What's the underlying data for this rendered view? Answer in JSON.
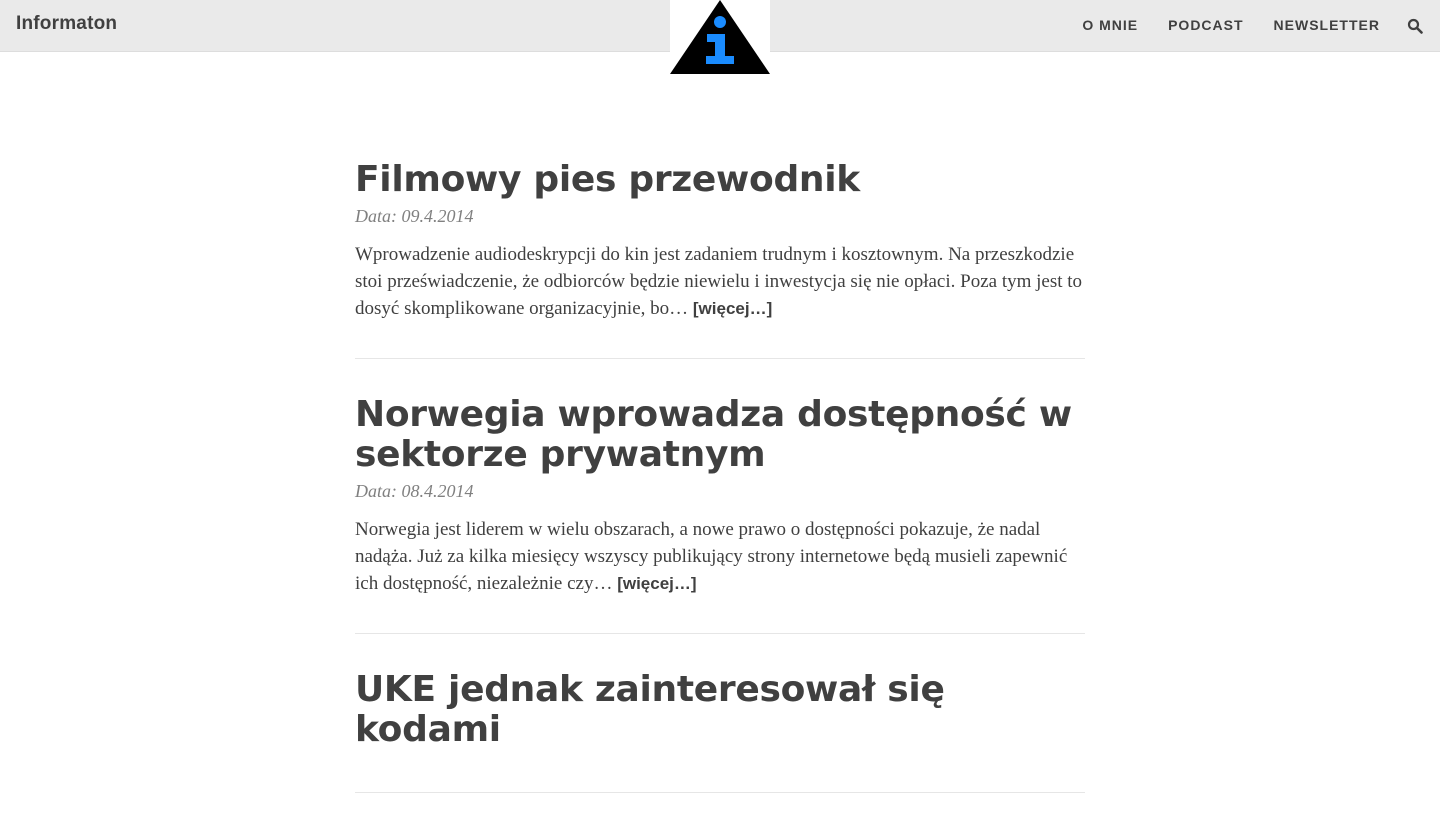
{
  "navbar": {
    "brand": "Informaton",
    "links": [
      "O MNIE",
      "PODCAST",
      "NEWSLETTER"
    ],
    "search_icon": "search-icon",
    "logo_icon": "info-triangle-icon"
  },
  "colors": {
    "navbar_bg": "#eaeaea",
    "text": "#404040",
    "meta": "#808080",
    "logo_black": "#000000",
    "logo_blue": "#1a8cff"
  },
  "posts": [
    {
      "title": "Filmowy pies przewodnik",
      "date": "Data: 09.4.2014",
      "excerpt": "Wprowadzenie audiodeskrypcji do kin jest zadaniem trudnym i kosztownym. Na przeszkodzie stoi przeświadczenie, że odbiorców będzie niewielu i inwestycja się nie opłaci. Poza tym jest to dosyć skomplikowane organizacyjnie, bo…",
      "more": "[więcej…]"
    },
    {
      "title": "Norwegia wprowadza dostępność w sektorze prywatnym",
      "date": "Data: 08.4.2014",
      "excerpt": "Norwegia jest liderem w wielu obszarach, a nowe prawo o dostępności pokazuje, że nadal nadąża. Już za kilka miesięcy wszyscy publikujący strony internetowe będą musieli zapewnić ich dostępność, niezależnie czy…",
      "more": "[więcej…]"
    },
    {
      "title": "UKE jednak zainteresował się kodami"
    }
  ]
}
